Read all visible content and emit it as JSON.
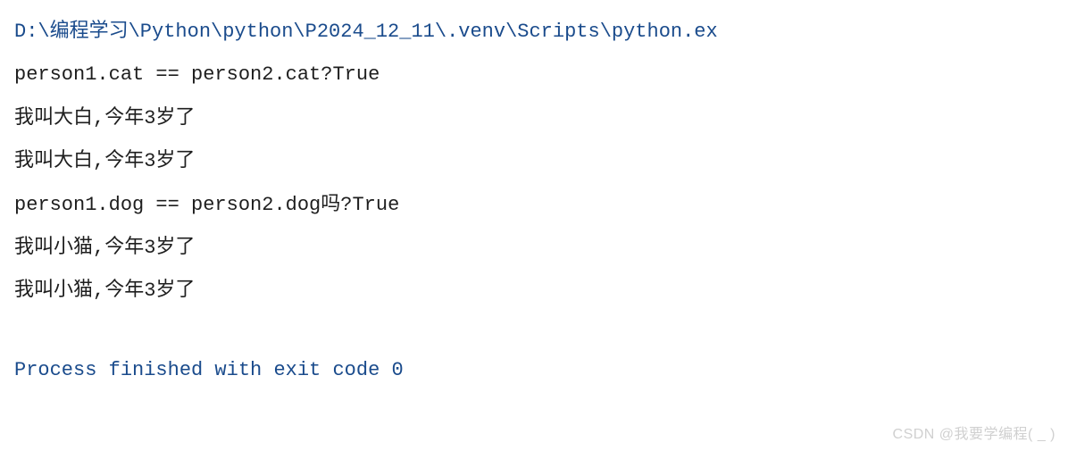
{
  "console": {
    "command_path": "D:\\编程学习\\Python\\python\\P2024_12_11\\.venv\\Scripts\\python.ex",
    "lines": [
      "person1.cat == person2.cat?True",
      "我叫大白,今年3岁了",
      "我叫大白,今年3岁了",
      "person1.dog == person2.dog吗?True",
      "我叫小猫,今年3岁了",
      "我叫小猫,今年3岁了"
    ],
    "exit_message": "Process finished with exit code 0"
  },
  "watermark": "CSDN @我要学编程( _ )"
}
